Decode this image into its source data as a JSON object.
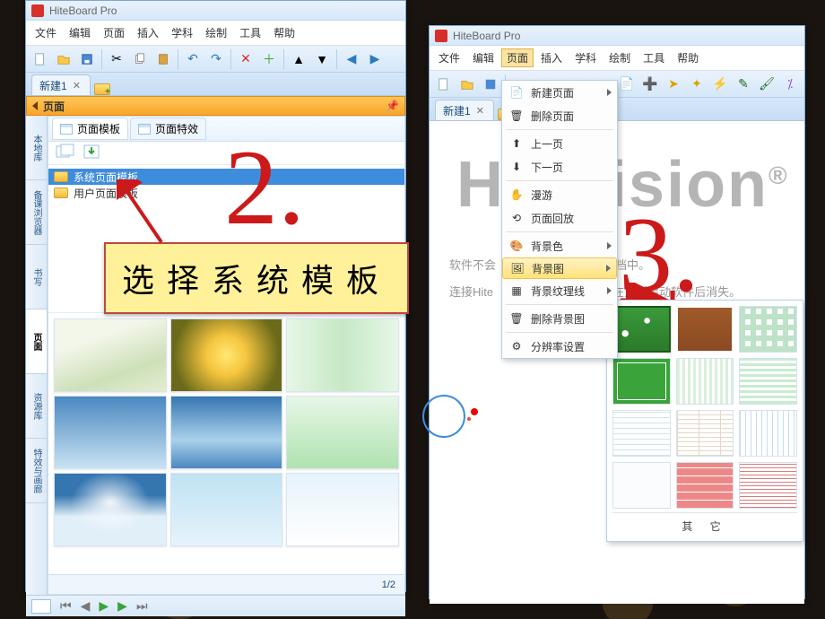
{
  "app_title": "HiteBoard Pro",
  "menus": [
    "文件",
    "编辑",
    "页面",
    "插入",
    "学科",
    "绘制",
    "工具",
    "帮助"
  ],
  "tab_name": "新建1",
  "page_panel_title": "页面",
  "tpl_tabs": {
    "templates": "页面模板",
    "effects": "页面特效"
  },
  "tree": {
    "system": "系统页面模板",
    "user": "用户页面模板"
  },
  "pager": "1/2",
  "side_tabs": [
    "本地库",
    "备课浏览器",
    "书写",
    "页面",
    "资源库",
    "特效与画廊"
  ],
  "big2": "2.",
  "callout2": "选择系统模板",
  "big3": "3.",
  "dropdown": {
    "new_page": "新建页面",
    "delete_page": "删除页面",
    "prev": "上一页",
    "next": "下一页",
    "roam": "漫游",
    "replay": "页面回放",
    "bgcolor": "背景色",
    "bgimage": "背景图",
    "bgtexture": "背景纹理线",
    "delete_bg": "删除背景图",
    "resolution": "分辨率设置"
  },
  "submenu_other": "其 它",
  "hite_logo": "HiteVision",
  "reg_mark": "®",
  "notice1": "软件不会",
  "notice1b": "文档中。",
  "notice2": "连接Hite",
  "notice2b": "将在重新启动软件后消失。"
}
